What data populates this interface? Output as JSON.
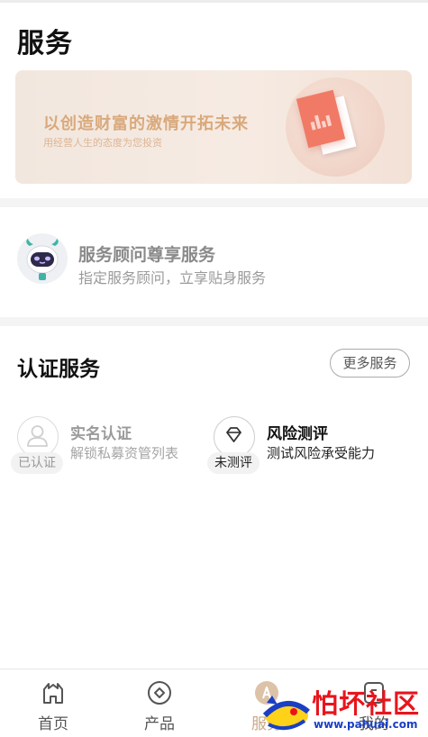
{
  "page": {
    "title": "服务"
  },
  "banner": {
    "title": "以创造财富的激情开拓未来",
    "subtitle": "用经营人生的态度为您投资"
  },
  "advisor": {
    "title": "服务顾问尊享服务",
    "subtitle": "指定服务顾问，立享贴身服务"
  },
  "auth": {
    "title": "认证服务",
    "more_label": "更多服务",
    "items": [
      {
        "name": "实名认证",
        "desc": "解锁私募资管列表",
        "badge": "已认证",
        "icon": "user-icon",
        "muted": true
      },
      {
        "name": "风险测评",
        "desc": "测试风险承受能力",
        "badge": "未测评",
        "icon": "diamond-icon",
        "muted": false
      }
    ]
  },
  "tabbar": {
    "items": [
      {
        "label": "首页",
        "icon": "home-icon"
      },
      {
        "label": "产品",
        "icon": "product-icon"
      },
      {
        "label": "服务",
        "icon": "service-icon",
        "active": true
      },
      {
        "label": "我的",
        "icon": "profile-icon"
      }
    ]
  },
  "watermark": {
    "text": "怕坏社区",
    "url": "www.pahuai.com"
  },
  "colors": {
    "accent": "#d9a97c",
    "banner_bg": "#f4e9e1",
    "text_muted": "#8a8a8a",
    "watermark_red": "#e8141c",
    "watermark_blue": "#1a3fc4"
  }
}
